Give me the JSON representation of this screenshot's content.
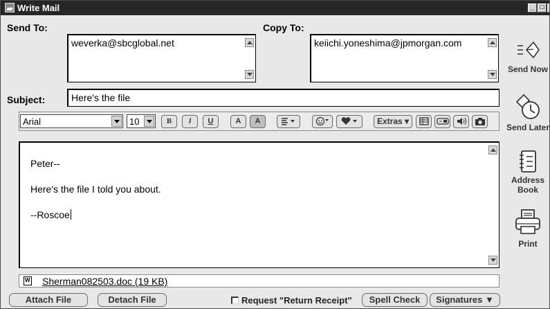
{
  "window": {
    "title": "Write Mail",
    "controls": {
      "minimize": "_",
      "maximize": "□",
      "close": "×"
    }
  },
  "header": {
    "send_to_label": "Send To:",
    "send_to_value": "weverka@sbcglobal.net",
    "copy_to_label": "Copy To:",
    "copy_to_value": "keiichi.yoneshima@jpmorgan.com",
    "subject_label": "Subject:",
    "subject_value": "Here's the file"
  },
  "toolbar": {
    "font_family": "Arial",
    "font_size": "10",
    "bold": "B",
    "italic": "I",
    "underline": "U",
    "text_color": "A",
    "background_color": "A",
    "extras_label": "Extras"
  },
  "message": {
    "lines": [
      "Peter--",
      "Here's the file I told you about.",
      "--Roscoe"
    ]
  },
  "attachment": {
    "file_label": "Sherman082503.doc (19 KB)"
  },
  "footer": {
    "attach_file": "Attach File",
    "detach_file": "Detach File",
    "return_receipt": "Request \"Return Receipt\"",
    "spell_check": "Spell Check",
    "signatures": "Signatures ▼"
  },
  "side_actions": {
    "send_now": "Send Now",
    "send_later": "Send Later",
    "address_book_line1": "Address",
    "address_book_line2": "Book",
    "print": "Print"
  }
}
